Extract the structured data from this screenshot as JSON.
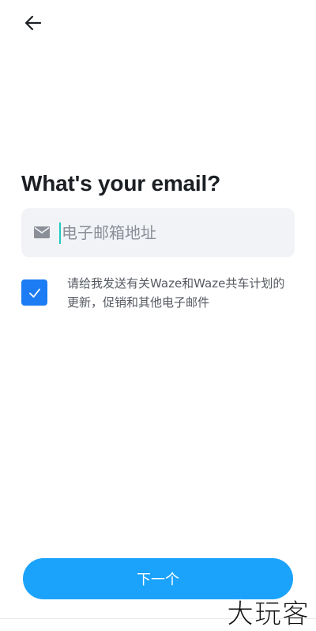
{
  "header": {
    "back_icon": "arrow-left-icon"
  },
  "main": {
    "title": "What's your email?",
    "email": {
      "icon": "envelope-icon",
      "value": "",
      "placeholder": "电子邮箱地址"
    },
    "consent": {
      "checked": true,
      "label": "请给我发送有关Waze和Waze共车计划的更新，促销和其他电子邮件"
    }
  },
  "footer": {
    "next_label": "下一个"
  },
  "watermark": "大玩客",
  "colors": {
    "primary_button": "#1ba3fb",
    "checkbox": "#1c7cf3",
    "caret": "#1ec9c2",
    "input_bg": "#f2f3f7",
    "title": "#1b1f23"
  }
}
